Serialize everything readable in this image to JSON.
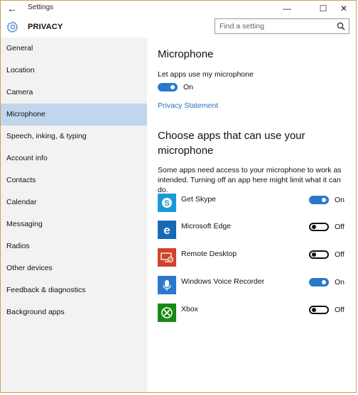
{
  "window": {
    "title": "Settings",
    "minimize": "—",
    "maximize": "☐",
    "close": "✕"
  },
  "header": {
    "section": "PRIVACY",
    "search_placeholder": "Find a setting"
  },
  "sidebar": {
    "items": [
      {
        "label": "General"
      },
      {
        "label": "Location"
      },
      {
        "label": "Camera"
      },
      {
        "label": "Microphone",
        "active": true
      },
      {
        "label": "Speech, inking, & typing"
      },
      {
        "label": "Account info"
      },
      {
        "label": "Contacts"
      },
      {
        "label": "Calendar"
      },
      {
        "label": "Messaging"
      },
      {
        "label": "Radios"
      },
      {
        "label": "Other devices"
      },
      {
        "label": "Feedback & diagnostics"
      },
      {
        "label": "Background apps"
      }
    ]
  },
  "main": {
    "title": "Microphone",
    "toggle_label": "Let apps use my microphone",
    "toggle_state": "On",
    "privacy_link": "Privacy Statement",
    "choose_heading": "Choose apps that can use your microphone",
    "description": "Some apps need access to your microphone to work as intended. Turning off an app here might limit what it can do.",
    "apps": [
      {
        "name": "Get Skype",
        "state": "On",
        "icon": "skype-icon",
        "color": "#1a9bd7"
      },
      {
        "name": "Microsoft Edge",
        "state": "Off",
        "icon": "edge-icon",
        "color": "#1769b8"
      },
      {
        "name": "Remote Desktop",
        "state": "Off",
        "icon": "remote-desktop-icon",
        "color": "#d2432a"
      },
      {
        "name": "Windows Voice Recorder",
        "state": "On",
        "icon": "voice-recorder-icon",
        "color": "#2b78cf"
      },
      {
        "name": "Xbox",
        "state": "Off",
        "icon": "xbox-icon",
        "color": "#168a16"
      }
    ]
  },
  "colors": {
    "accent": "#2a78cd",
    "sidebar_bg": "#f2f2f2",
    "active_bg": "#c1d6ec",
    "link": "#2a6fbd"
  }
}
